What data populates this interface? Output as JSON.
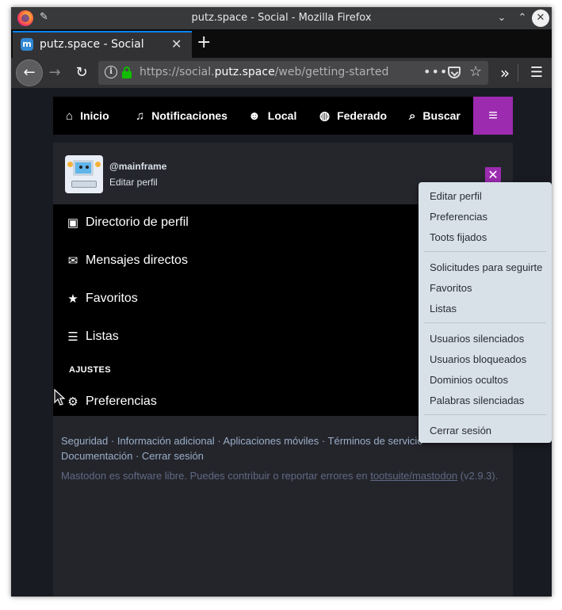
{
  "window": {
    "title": "putz.space - Social - Mozilla Firefox",
    "close_glyph": "✕",
    "min_glyph": "⌄",
    "max_glyph": "⌃"
  },
  "tab": {
    "title": "putz.space - Social",
    "favicon_letter": "m",
    "close_glyph": "✕",
    "new_tab_glyph": "+"
  },
  "url": {
    "prefix": "https://social.",
    "domain": "putz.space",
    "path": "/web/getting-started"
  },
  "mastodon_nav": [
    {
      "label": "Inicio",
      "icon": "home-icon",
      "glyph": "⌂"
    },
    {
      "label": "Notificaciones",
      "icon": "bell-icon",
      "glyph": "🔔"
    },
    {
      "label": "Local",
      "icon": "users-icon",
      "glyph": "👥"
    },
    {
      "label": "Federado",
      "icon": "globe-icon",
      "glyph": "🌐"
    },
    {
      "label": "Buscar",
      "icon": "search-icon",
      "glyph": "🔍"
    }
  ],
  "hamburger_glyph": "≡",
  "profile": {
    "acct": "@mainframe",
    "edit_label": "Editar perfil",
    "close_glyph": "✕"
  },
  "sidebar": {
    "items": [
      {
        "label": "Directorio de perfil",
        "icon": "address-book-icon",
        "glyph": "▣"
      },
      {
        "label": "Mensajes directos",
        "icon": "envelope-icon",
        "glyph": "✉"
      },
      {
        "label": "Favoritos",
        "icon": "star-icon",
        "glyph": "★"
      },
      {
        "label": "Listas",
        "icon": "list-icon",
        "glyph": "☰"
      }
    ],
    "heading": "AJUSTES",
    "settings_item": {
      "label": "Preferencias",
      "icon": "cogs-icon",
      "glyph": "⚙"
    }
  },
  "footer": {
    "links": [
      "Seguridad",
      "Información adicional",
      "Aplicaciones móviles",
      "Términos de servicio",
      "Documentación",
      "Cerrar sesión"
    ],
    "separator": " · ",
    "note_before": "Mastodon es software libre. Puedes contribuir o reportar errores en ",
    "note_link": "tootsuite/mastodon",
    "note_after": " (v2.9.3)."
  },
  "dropdown": {
    "groups": [
      [
        "Editar perfil",
        "Preferencias",
        "Toots fijados"
      ],
      [
        "Solicitudes para seguirte",
        "Favoritos",
        "Listas"
      ],
      [
        "Usuarios silenciados",
        "Usuarios bloqueados",
        "Dominios ocultos",
        "Palabras silenciadas"
      ],
      [
        "Cerrar sesión"
      ]
    ]
  },
  "colors": {
    "accent": "#9c2bb0",
    "link": "#9baec8",
    "dropdown_bg": "#d9e1e8"
  }
}
